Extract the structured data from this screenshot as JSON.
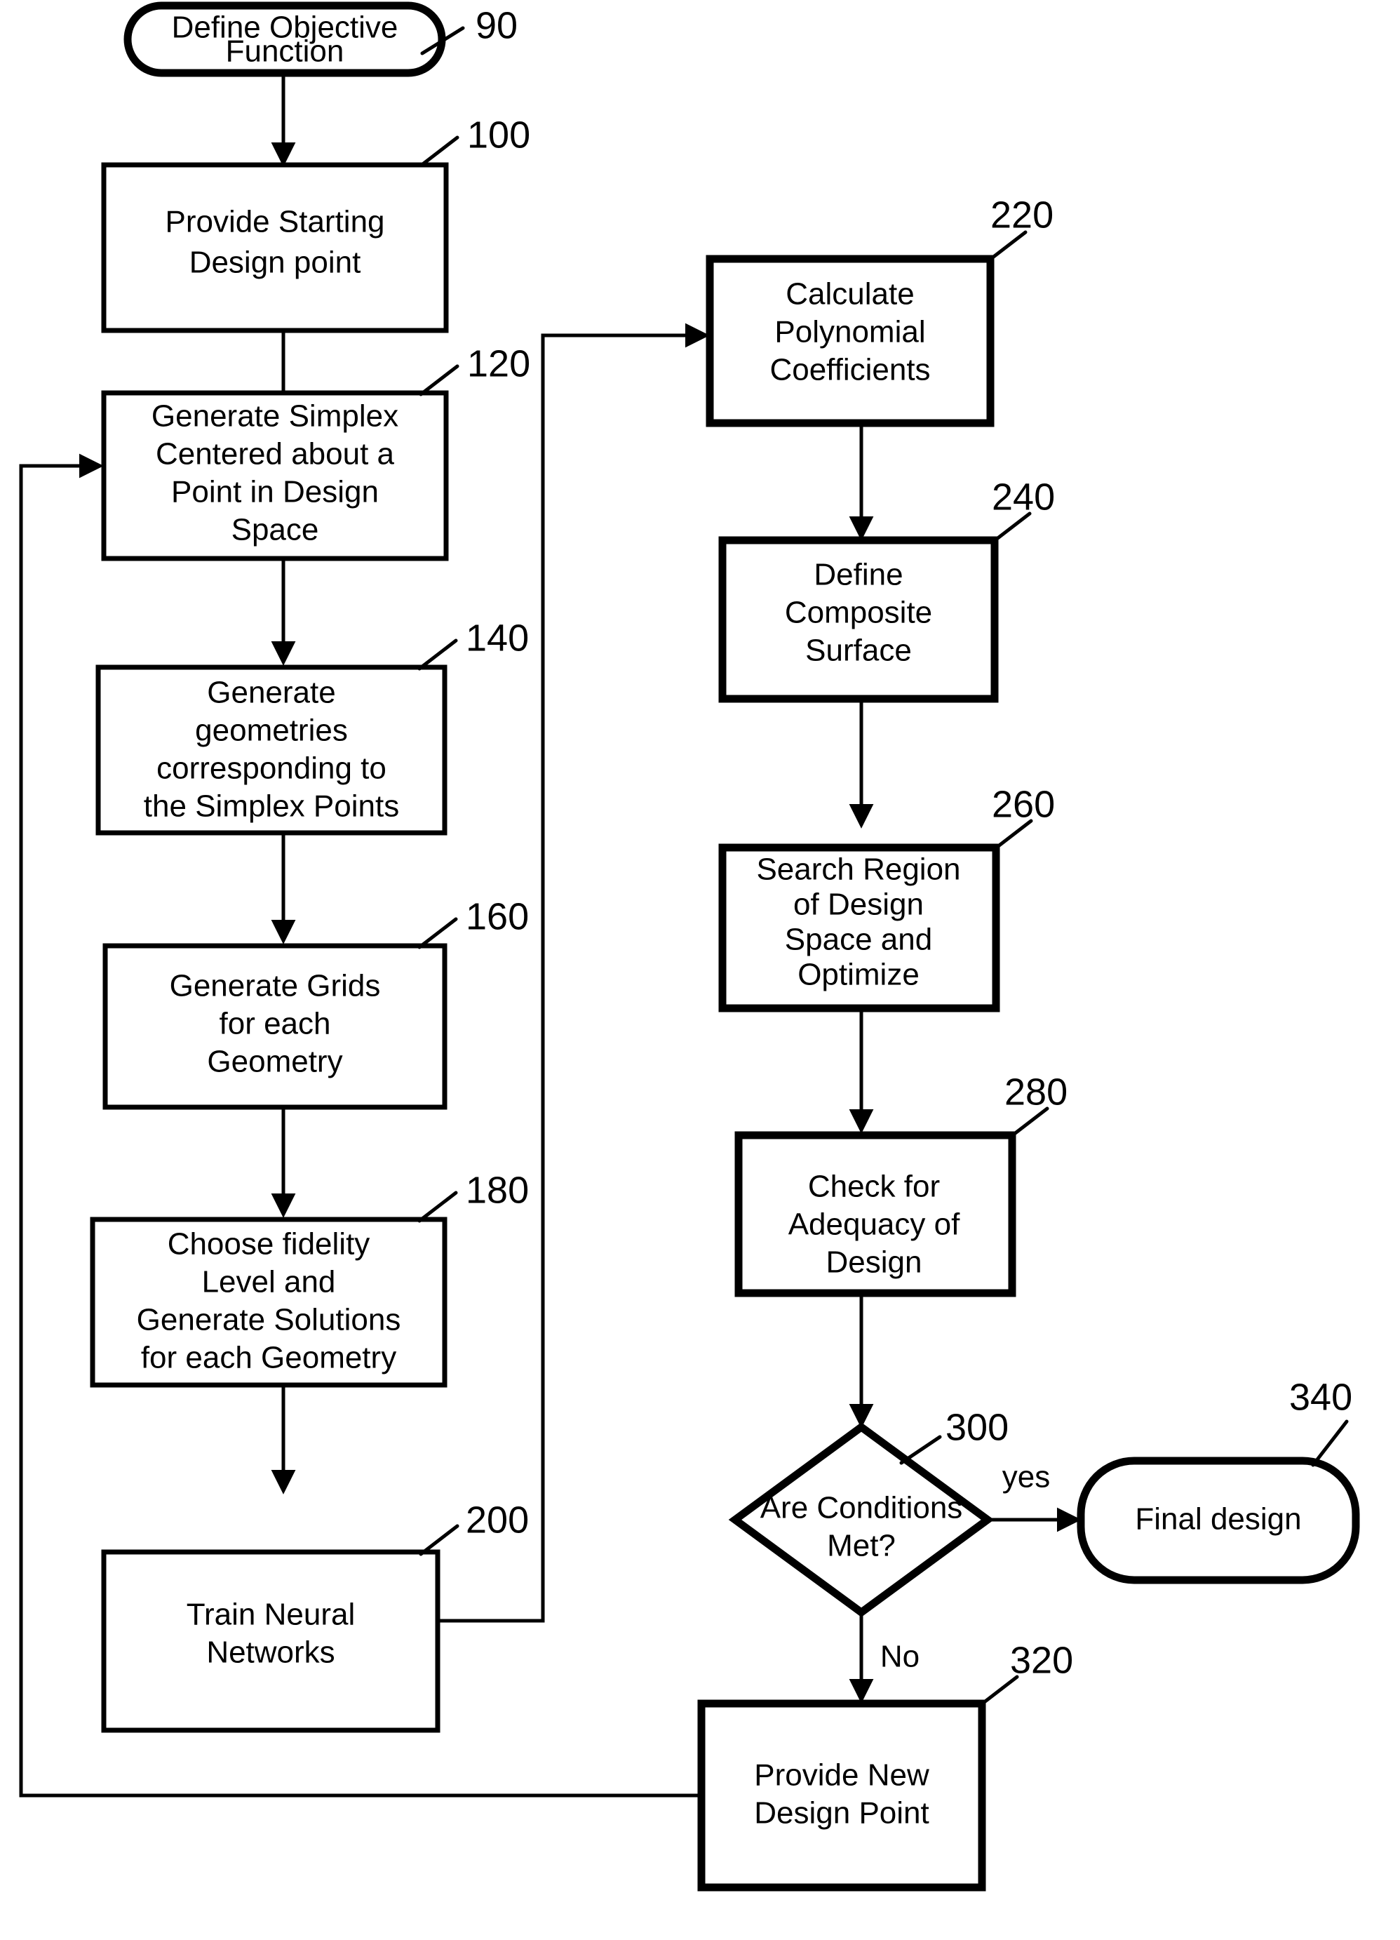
{
  "diagram": {
    "type": "flowchart",
    "title": "Design optimization process flowchart",
    "nodes": [
      {
        "id": "n90",
        "ref": "90",
        "shape": "terminator",
        "lines": [
          "Define Objective",
          "Function"
        ],
        "text": "Define Objective Function"
      },
      {
        "id": "n100",
        "ref": "100",
        "shape": "process",
        "lines": [
          "Provide Starting",
          "Design point"
        ],
        "text": "Provide Starting Design point"
      },
      {
        "id": "n120",
        "ref": "120",
        "shape": "process",
        "lines": [
          "Generate Simplex",
          "Centered about a",
          "Point in Design",
          "Space"
        ],
        "text": "Generate Simplex Centered about a Point in Design Space"
      },
      {
        "id": "n140",
        "ref": "140",
        "shape": "process",
        "lines": [
          "Generate",
          "geometries",
          "corresponding to",
          "the Simplex Points"
        ],
        "text": "Generate geometries corresponding to the Simplex Points"
      },
      {
        "id": "n160",
        "ref": "160",
        "shape": "process",
        "lines": [
          "Generate Grids",
          "for each",
          "Geometry"
        ],
        "text": "Generate Grids for each Geometry"
      },
      {
        "id": "n180",
        "ref": "180",
        "shape": "process",
        "lines": [
          "Choose fidelity",
          "Level and",
          "Generate Solutions",
          "for each Geometry"
        ],
        "text": "Choose fidelity Level and Generate Solutions for each Geometry"
      },
      {
        "id": "n200",
        "ref": "200",
        "shape": "process",
        "lines": [
          "Train Neural",
          "Networks"
        ],
        "text": "Train Neural Networks"
      },
      {
        "id": "n220",
        "ref": "220",
        "shape": "process",
        "lines": [
          "Calculate",
          "Polynomial",
          "Coefficients"
        ],
        "text": "Calculate Polynomial Coefficients"
      },
      {
        "id": "n240",
        "ref": "240",
        "shape": "process",
        "lines": [
          "Define",
          "Composite",
          "Surface"
        ],
        "text": "Define Composite Surface"
      },
      {
        "id": "n260",
        "ref": "260",
        "shape": "process",
        "lines": [
          "Search Region",
          "of Design",
          "Space and",
          "Optimize"
        ],
        "text": "Search Region of Design Space and Optimize"
      },
      {
        "id": "n280",
        "ref": "280",
        "shape": "process",
        "lines": [
          "Check for",
          "Adequacy of",
          "Design"
        ],
        "text": "Check for Adequacy of Design"
      },
      {
        "id": "n300",
        "ref": "300",
        "shape": "decision",
        "lines": [
          "Are Conditions",
          "Met?"
        ],
        "text": "Are Conditions Met?"
      },
      {
        "id": "n320",
        "ref": "320",
        "shape": "process",
        "lines": [
          "Provide New",
          "Design Point"
        ],
        "text": "Provide New Design Point"
      },
      {
        "id": "n340",
        "ref": "340",
        "shape": "terminator",
        "lines": [
          "Final design"
        ],
        "text": "Final design"
      }
    ],
    "edge_labels": {
      "yes": "yes",
      "no": "No"
    },
    "colors": {
      "stroke": "#000000",
      "fill": "#ffffff",
      "text": "#000000"
    }
  }
}
